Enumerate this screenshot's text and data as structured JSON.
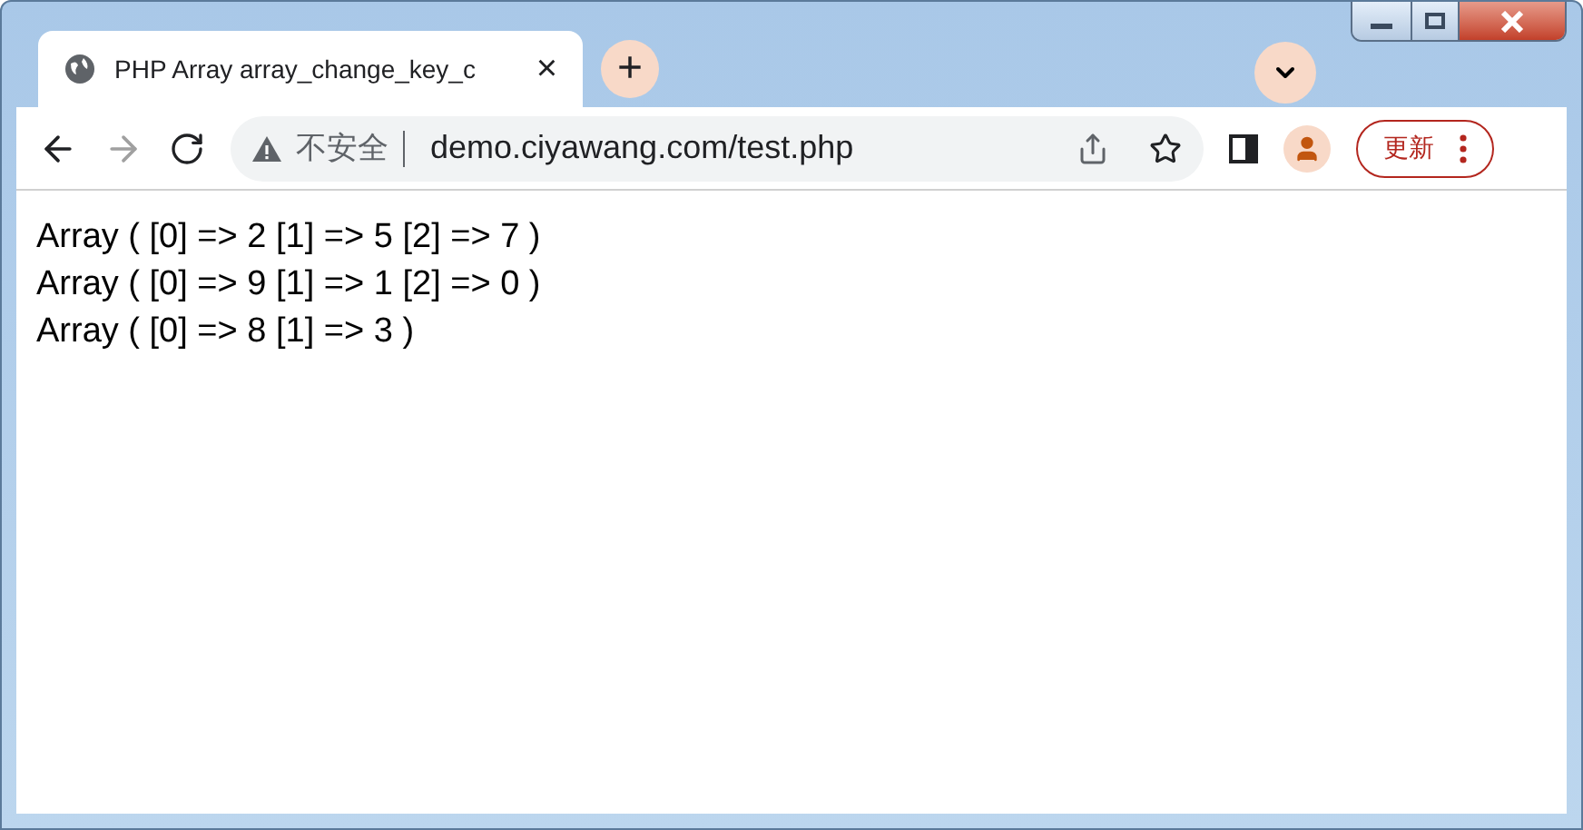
{
  "tab": {
    "title": "PHP Array array_change_key_c",
    "close": "×"
  },
  "new_tab": "+",
  "address_bar": {
    "security": "不安全",
    "url": "demo.ciyawang.com/test.php"
  },
  "update_button": "更新",
  "content": {
    "lines": [
      "Array ( [0] => 2 [1] => 5 [2] => 7 )",
      "Array ( [0] => 9 [1] => 1 [2] => 0 )",
      "Array ( [0] => 8 [1] => 3 )"
    ]
  }
}
